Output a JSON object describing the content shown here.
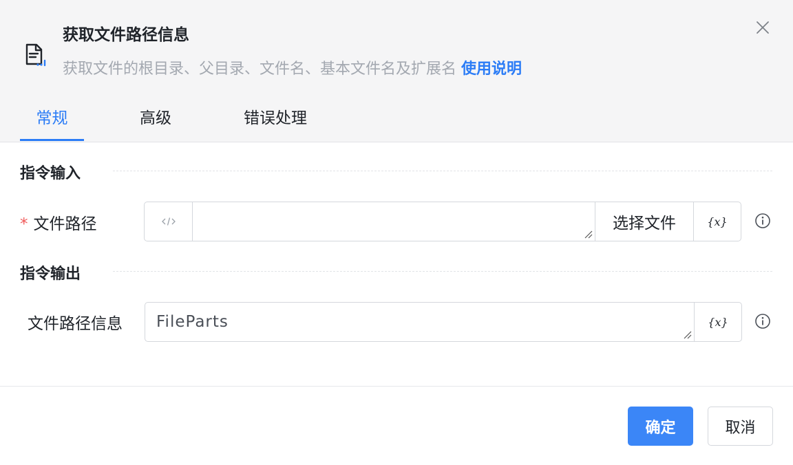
{
  "header": {
    "title": "获取文件路径信息",
    "subtitle": "获取文件的根目录、父目录、文件名、基本文件名及扩展名",
    "help_link": "使用说明"
  },
  "tabs": [
    {
      "label": "常规",
      "active": true
    },
    {
      "label": "高级",
      "active": false
    },
    {
      "label": "错误处理",
      "active": false
    }
  ],
  "input_section": {
    "title": "指令输入",
    "file_path": {
      "required_mark": "*",
      "label": "文件路径",
      "value": "",
      "select_button": "选择文件",
      "variable_button": "{x}"
    }
  },
  "output_section": {
    "title": "指令输出",
    "file_path_info": {
      "label": "文件路径信息",
      "value": "FileParts",
      "variable_button": "{x}"
    }
  },
  "footer": {
    "confirm_label": "确定",
    "cancel_label": "取消"
  },
  "colors": {
    "accent": "#2b7cf6",
    "primary_button": "#3b86f7",
    "required": "#f05a5a",
    "header_bg": "#f5f5f6"
  }
}
